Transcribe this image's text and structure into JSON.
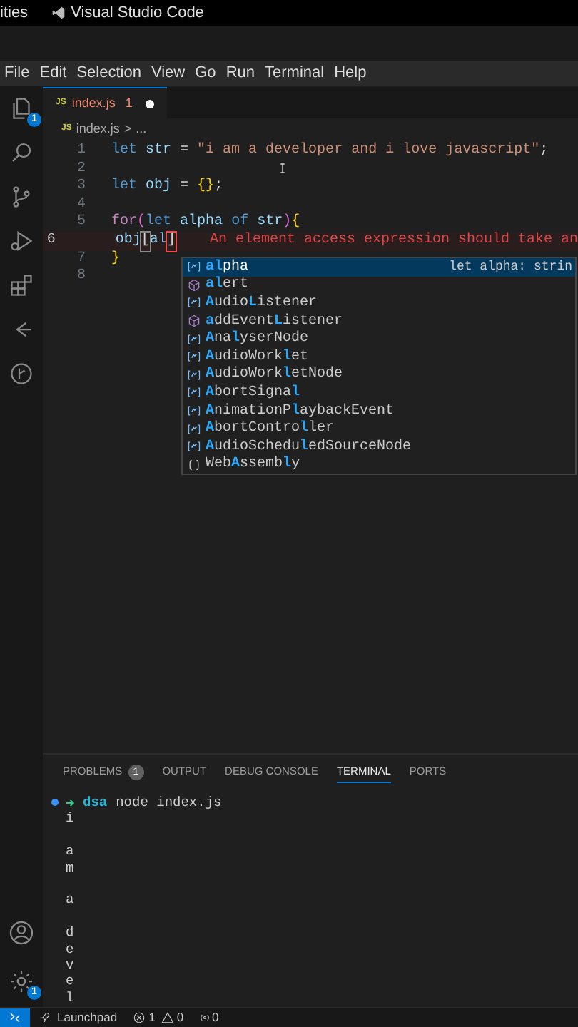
{
  "top_bar": {
    "left_text": "ities",
    "app_title": "Visual Studio Code"
  },
  "menu": [
    "File",
    "Edit",
    "Selection",
    "View",
    "Go",
    "Run",
    "Terminal",
    "Help"
  ],
  "activity_bar": {
    "items": [
      {
        "kind": "explorer",
        "badge": "1"
      },
      {
        "kind": "search"
      },
      {
        "kind": "source-control"
      },
      {
        "kind": "run-debug"
      },
      {
        "kind": "extensions"
      },
      {
        "kind": "remote"
      },
      {
        "kind": "graph"
      }
    ],
    "bottom": [
      {
        "kind": "account"
      },
      {
        "kind": "settings",
        "badge": "1"
      }
    ]
  },
  "tabs": [
    {
      "label": "index.js",
      "icon": "JS",
      "problems": "1",
      "modified": true,
      "selected": true
    }
  ],
  "breadcrumb": {
    "icon": "JS",
    "file": "index.js",
    "separator": ">",
    "rest": "..."
  },
  "code": [
    {
      "number": "1",
      "current": false,
      "tokens": [
        {
          "kind": "keyword",
          "text": "let"
        },
        {
          "kind": "variable",
          "text": " str"
        },
        {
          "kind": "operator",
          "text": " = "
        },
        {
          "kind": "string",
          "text": "\"i am a developer and i love javascript\""
        },
        {
          "kind": "plain",
          "text": ";"
        }
      ]
    },
    {
      "number": "2",
      "current": false
    },
    {
      "number": "3",
      "current": false,
      "tokens": [
        {
          "kind": "keyword",
          "text": "let"
        },
        {
          "kind": "variable",
          "text": " obj"
        },
        {
          "kind": "operator",
          "text": " = "
        },
        {
          "kind": "brace",
          "text": "{}"
        },
        {
          "kind": "plain",
          "text": ";"
        }
      ]
    },
    {
      "number": "4",
      "current": false
    },
    {
      "number": "5",
      "current": false,
      "tokens": [
        {
          "kind": "control",
          "text": "for"
        },
        {
          "kind": "paren",
          "text": "("
        },
        {
          "kind": "keyword",
          "text": "let"
        },
        {
          "kind": "variable",
          "text": " alpha"
        },
        {
          "kind": "keyword",
          "text": " of"
        },
        {
          "kind": "variable",
          "text": " str"
        },
        {
          "kind": "paren",
          "text": ")"
        },
        {
          "kind": "brace",
          "text": "{"
        }
      ]
    },
    {
      "number": "6",
      "current": true,
      "indent": true,
      "tokens": [
        {
          "kind": "variable",
          "text": "obj"
        },
        {
          "kind": "bracket",
          "text": "["
        },
        {
          "kind": "variable",
          "text": "al"
        },
        {
          "kind": "error-bracket",
          "text": "]"
        }
      ],
      "diagnostic": "An element access expression should take an"
    },
    {
      "number": "7",
      "current": false,
      "tokens": [
        {
          "kind": "brace",
          "text": "}"
        }
      ]
    },
    {
      "number": "8",
      "current": false
    }
  ],
  "suggestions": [
    {
      "kind": "variable",
      "label": "**al**pha",
      "detail": "let alpha: strin",
      "selected": true
    },
    {
      "kind": "method",
      "label": "**al**ert",
      "selected": false
    },
    {
      "kind": "variable",
      "label": "**A**udio**L**istener",
      "selected": false
    },
    {
      "kind": "method",
      "label": "**a**ddEvent**L**istener",
      "selected": false
    },
    {
      "kind": "variable",
      "label": "**A**na**l**yserNode",
      "selected": false
    },
    {
      "kind": "variable",
      "label": "**A**udioWork**l**et",
      "selected": false
    },
    {
      "kind": "variable",
      "label": "**A**udioWork**l**etNode",
      "selected": false
    },
    {
      "kind": "variable",
      "label": "**A**bortSigna**l**",
      "selected": false
    },
    {
      "kind": "variable",
      "label": "**A**nimationP**l**aybackEvent",
      "selected": false
    },
    {
      "kind": "variable",
      "label": "**A**bortContro**l**ler",
      "selected": false
    },
    {
      "kind": "variable",
      "label": "**A**udioSchedu**l**edSourceNode",
      "selected": false
    },
    {
      "kind": "module",
      "label": "Web**A**ssemb**l**y",
      "selected": false
    }
  ],
  "panel_tabs": [
    {
      "label": "PROBLEMS",
      "badge": "1",
      "selected": false
    },
    {
      "label": "OUTPUT",
      "selected": false
    },
    {
      "label": "DEBUG CONSOLE",
      "selected": false
    },
    {
      "label": "TERMINAL",
      "selected": true
    },
    {
      "label": "PORTS",
      "selected": false
    }
  ],
  "terminal": {
    "prompt": {
      "directory": "dsa",
      "command": "node index.js"
    },
    "output": [
      {
        "kind": "text",
        "text": "i"
      },
      {
        "kind": "blank"
      },
      {
        "kind": "text",
        "text": "a"
      },
      {
        "kind": "text",
        "text": "m"
      },
      {
        "kind": "blank"
      },
      {
        "kind": "text",
        "text": "a"
      },
      {
        "kind": "blank"
      },
      {
        "kind": "text",
        "text": "d"
      },
      {
        "kind": "text",
        "text": "e"
      },
      {
        "kind": "text",
        "text": "v"
      },
      {
        "kind": "text",
        "text": "e"
      },
      {
        "kind": "text",
        "text": "l"
      }
    ]
  },
  "status_bar": {
    "launchpad": "Launchpad",
    "errors": "1",
    "warnings": "0",
    "ports": "0"
  }
}
